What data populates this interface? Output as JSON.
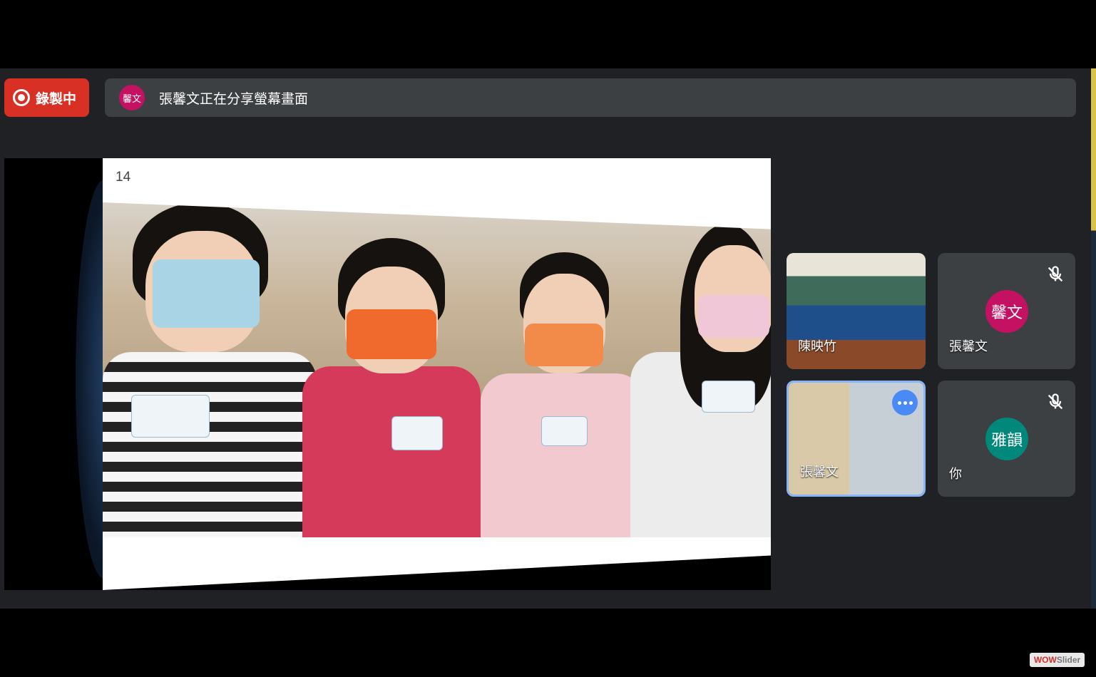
{
  "recording": {
    "label": "錄製中"
  },
  "share_banner": {
    "avatar_text": "馨文",
    "avatar_color": "#c51162",
    "message": "張馨文正在分享螢幕畫面"
  },
  "presentation": {
    "slide_number": "14"
  },
  "participants": [
    {
      "name": "陳映竹",
      "type": "video"
    },
    {
      "name": "張馨文",
      "avatar_text": "馨文",
      "avatar_color": "#c51162",
      "muted": true
    },
    {
      "name": "張馨文",
      "type": "video",
      "active": true
    },
    {
      "name": "你",
      "avatar_text": "雅韻",
      "avatar_color": "#00897b",
      "muted": true
    }
  ],
  "watermark": {
    "brand": "WOW",
    "suffix": "Slider"
  },
  "colors": {
    "record": "#d93025",
    "panel": "#202124",
    "bar": "#3c4043",
    "active_border": "#8ab4f8"
  }
}
